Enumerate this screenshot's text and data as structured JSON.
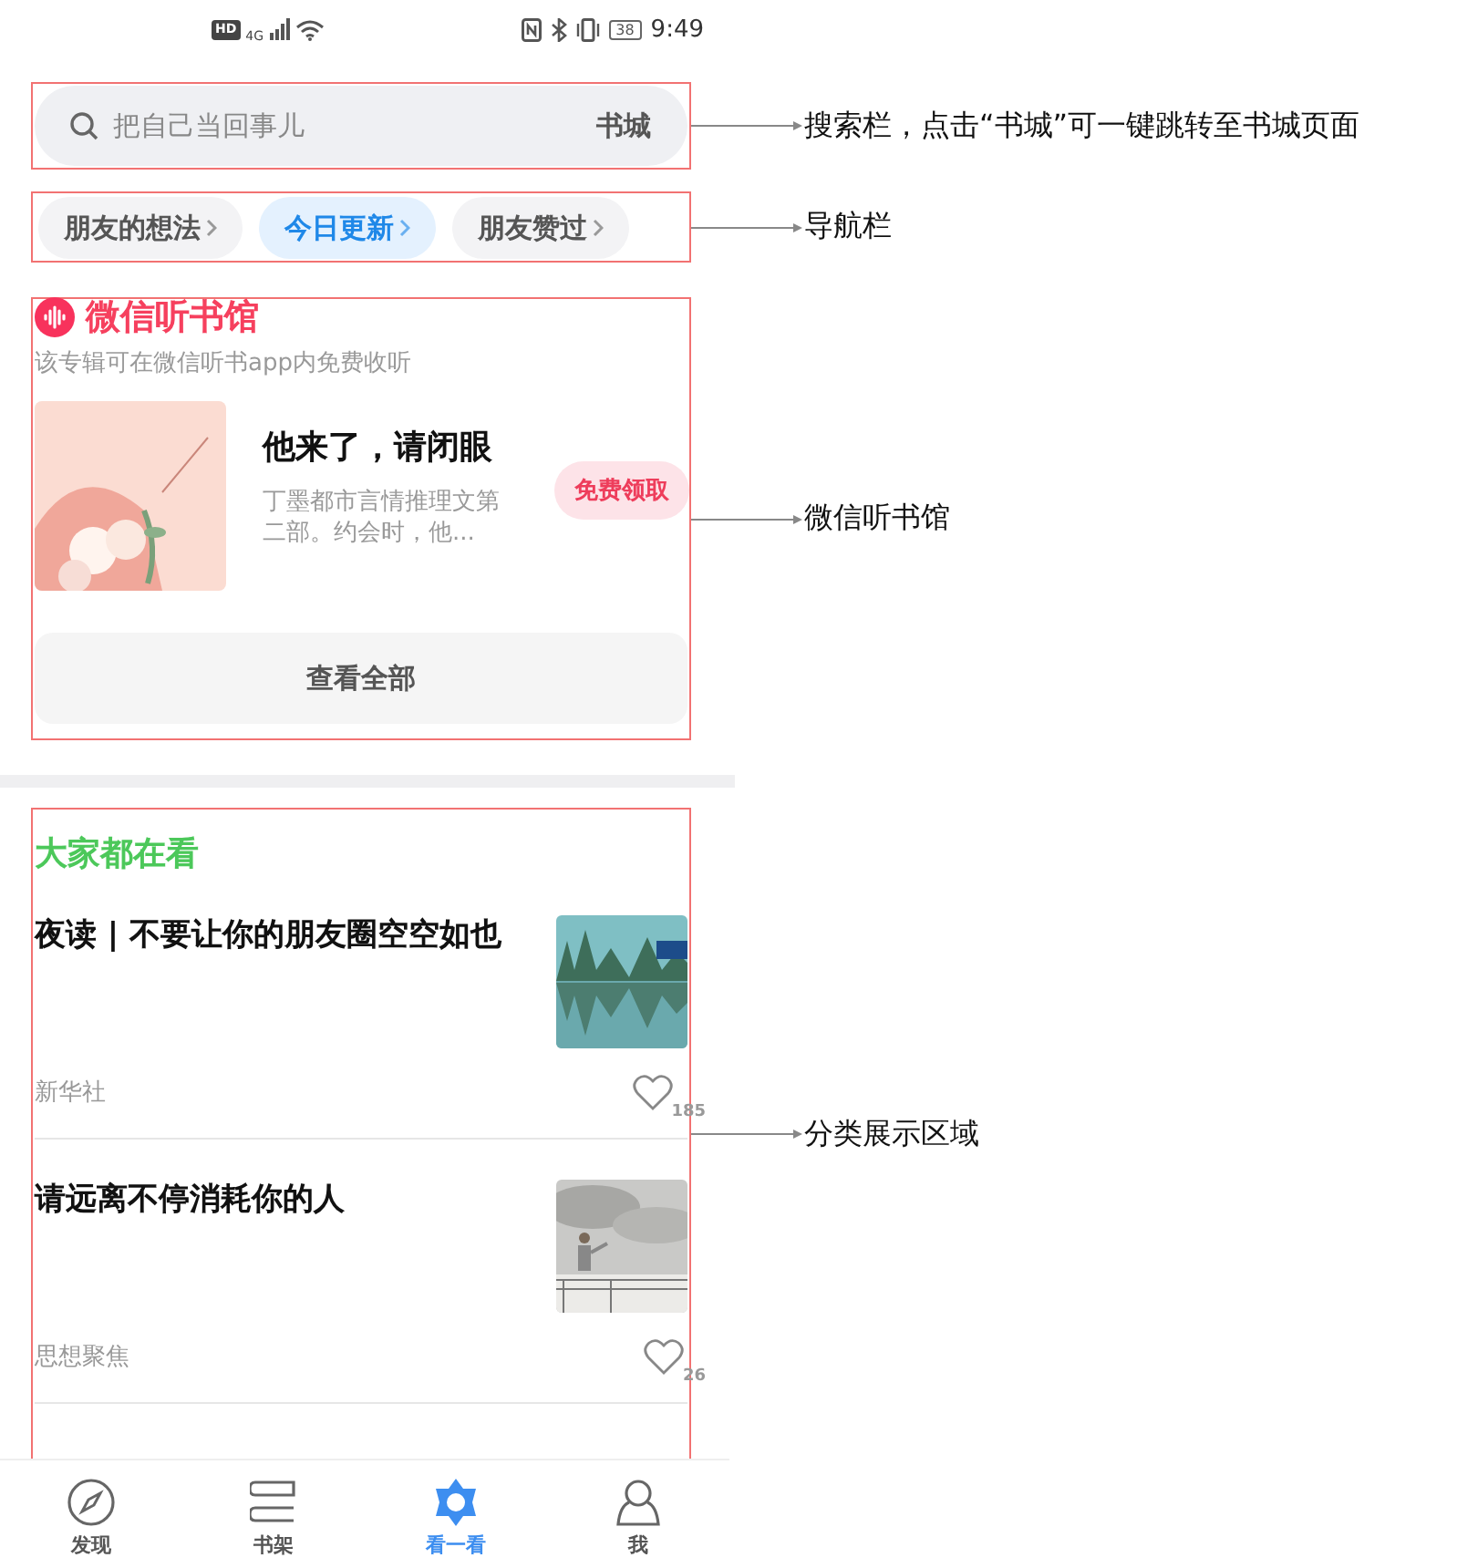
{
  "status_bar": {
    "hd": "HD",
    "network": "4G",
    "battery": "38",
    "time": "9:49"
  },
  "search": {
    "placeholder": "把自己当回事儿",
    "action": "书城"
  },
  "nav_chips": [
    {
      "label": "朋友的想法",
      "selected": false
    },
    {
      "label": "今日更新",
      "selected": true
    },
    {
      "label": "朋友赞过",
      "selected": false
    }
  ],
  "listen": {
    "title": "微信听书馆",
    "subtitle": "该专辑可在微信听书app内免费收听",
    "book": {
      "title": "他来了，请闭眼",
      "description": "丁墨都市言情推理文第二部。约会时，他...",
      "button": "免费领取"
    },
    "view_all": "查看全部"
  },
  "feed": {
    "title": "大家都在看",
    "articles": [
      {
        "title": "夜读 | 不要让你的朋友圈空空如也",
        "source": "新华社",
        "likes": "185",
        "kind": "lake"
      },
      {
        "title": "请远离不停消耗你的人",
        "source": "思想聚焦",
        "likes": "26",
        "kind": "sky"
      }
    ]
  },
  "tab_bar": [
    {
      "label": "发现",
      "kind": "compass",
      "selected": false
    },
    {
      "label": "书架",
      "kind": "books",
      "selected": false
    },
    {
      "label": "看一看",
      "kind": "star",
      "selected": true
    },
    {
      "label": "我",
      "kind": "person",
      "selected": false
    }
  ],
  "annotations": [
    "搜索栏，点击“书城”可一键跳转至书城页面",
    "导航栏",
    "微信听书馆",
    "分类展示区域"
  ]
}
